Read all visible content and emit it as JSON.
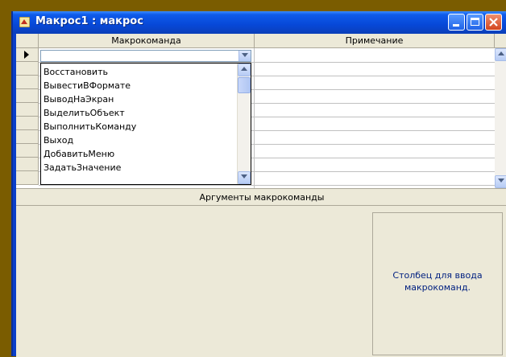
{
  "window": {
    "title": "Макрос1 : макрос",
    "icon": "macro-icon",
    "controls": [
      "minimize-icon",
      "maximize-icon",
      "close-icon"
    ]
  },
  "grid": {
    "columns": [
      "Макрокоманда",
      "Примечание"
    ],
    "current_row_value": ""
  },
  "dropdown": {
    "items": [
      "Восстановить",
      "ВывестиВФормате",
      "ВыводНаЭкран",
      "ВыделитьОбъект",
      "ВыполнитьКоманду",
      "Выход",
      "ДобавитьМеню",
      "ЗадатьЗначение"
    ]
  },
  "arguments": {
    "label": "Аргументы макрокоманды",
    "hint": "Столбец для ввода макрокоманд."
  },
  "colors": {
    "titlebar": "#0748d8",
    "background": "#7a5c00",
    "hint_text": "#002080"
  }
}
